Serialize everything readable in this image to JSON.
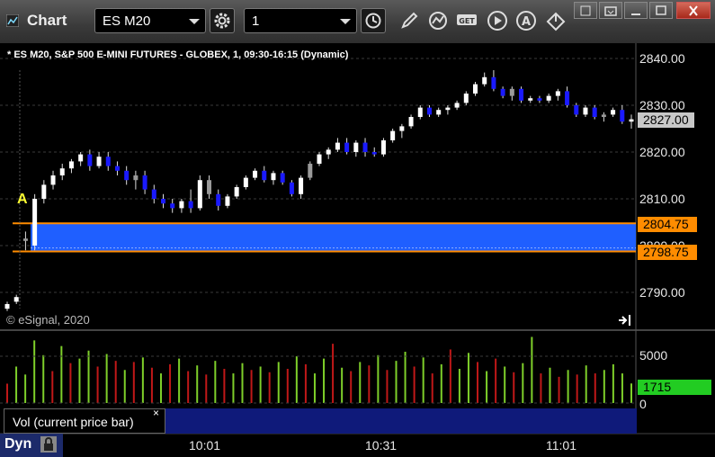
{
  "window": {
    "title": "Chart"
  },
  "toolbar": {
    "symbol_value": "ES M20",
    "interval_value": "1",
    "icons": [
      "settings-icon",
      "clock-icon",
      "pencil-icon",
      "indicator-icon",
      "get-icon",
      "play-icon",
      "alert-icon",
      "cursor-icon"
    ]
  },
  "chart": {
    "header_text": "* ES M20, S&P 500 E-MINI FUTURES - GLOBEX, 1, 09:30-16:15 (Dynamic)",
    "copyright": "© eSignal, 2020",
    "marker_label": "A",
    "price_axis": [
      "2840.00",
      "2830.00",
      "2820.00",
      "2810.00",
      "2800.00",
      "2790.00"
    ],
    "last_price": "2827.00",
    "zone_high": "2804.75",
    "zone_low": "2798.75",
    "time_axis": [
      "10:01",
      "10:31",
      "11:01"
    ],
    "colors": {
      "up_candle": "#ffffff",
      "down_candle": "#1a1aff",
      "zone_fill": "#1f5fff",
      "zone_border": "#ff8c00",
      "volume_up": "#7ecf2a",
      "volume_down": "#c01818",
      "last_price_bg": "#c8c8c8",
      "volume_last_bg": "#22cc22"
    }
  },
  "volume": {
    "axis": [
      "5000",
      "0"
    ],
    "last_value": "1715",
    "study_label": "Vol (current price bar)",
    "close_glyph": "×"
  },
  "status": {
    "mode": "Dyn"
  },
  "chart_data": {
    "type": "candlestick",
    "price_range": [
      2786,
      2843
    ],
    "candles": [
      {
        "o": 2786.5,
        "h": 2788,
        "l": 2786,
        "c": 2787.5,
        "dir": "up"
      },
      {
        "o": 2788,
        "h": 2789.5,
        "l": 2787.5,
        "c": 2789,
        "dir": "up"
      },
      {
        "o": 2801,
        "h": 2803,
        "l": 2799,
        "c": 2801.5,
        "dir": "flat"
      },
      {
        "o": 2800,
        "h": 2811,
        "l": 2799,
        "c": 2810,
        "dir": "up"
      },
      {
        "o": 2810,
        "h": 2814,
        "l": 2809,
        "c": 2813,
        "dir": "up"
      },
      {
        "o": 2813,
        "h": 2816,
        "l": 2812,
        "c": 2815,
        "dir": "up"
      },
      {
        "o": 2815,
        "h": 2817.5,
        "l": 2814,
        "c": 2816.5,
        "dir": "up"
      },
      {
        "o": 2816.5,
        "h": 2818.5,
        "l": 2815.5,
        "c": 2818,
        "dir": "up"
      },
      {
        "o": 2818,
        "h": 2820,
        "l": 2817,
        "c": 2819.5,
        "dir": "up"
      },
      {
        "o": 2819.5,
        "h": 2820.5,
        "l": 2816,
        "c": 2817,
        "dir": "down"
      },
      {
        "o": 2817,
        "h": 2820,
        "l": 2816.5,
        "c": 2819,
        "dir": "up"
      },
      {
        "o": 2819,
        "h": 2820,
        "l": 2816,
        "c": 2817,
        "dir": "down"
      },
      {
        "o": 2817,
        "h": 2818,
        "l": 2815,
        "c": 2816,
        "dir": "down"
      },
      {
        "o": 2816,
        "h": 2817,
        "l": 2813,
        "c": 2814,
        "dir": "down"
      },
      {
        "o": 2814,
        "h": 2816,
        "l": 2812,
        "c": 2815,
        "dir": "flat"
      },
      {
        "o": 2815,
        "h": 2816,
        "l": 2811,
        "c": 2812,
        "dir": "down"
      },
      {
        "o": 2812,
        "h": 2813,
        "l": 2809,
        "c": 2810,
        "dir": "down"
      },
      {
        "o": 2810,
        "h": 2811,
        "l": 2808,
        "c": 2809,
        "dir": "down"
      },
      {
        "o": 2809,
        "h": 2810,
        "l": 2807,
        "c": 2808,
        "dir": "down"
      },
      {
        "o": 2808,
        "h": 2810,
        "l": 2807,
        "c": 2809.5,
        "dir": "up"
      },
      {
        "o": 2809.5,
        "h": 2812,
        "l": 2807,
        "c": 2808,
        "dir": "down"
      },
      {
        "o": 2808,
        "h": 2815,
        "l": 2807.5,
        "c": 2814,
        "dir": "up"
      },
      {
        "o": 2814,
        "h": 2815,
        "l": 2810,
        "c": 2811,
        "dir": "flat"
      },
      {
        "o": 2811,
        "h": 2812,
        "l": 2807.5,
        "c": 2808.5,
        "dir": "down"
      },
      {
        "o": 2808.5,
        "h": 2811,
        "l": 2808,
        "c": 2810.5,
        "dir": "up"
      },
      {
        "o": 2810.5,
        "h": 2813,
        "l": 2810,
        "c": 2812.5,
        "dir": "up"
      },
      {
        "o": 2812.5,
        "h": 2815,
        "l": 2812,
        "c": 2814.5,
        "dir": "up"
      },
      {
        "o": 2814.5,
        "h": 2816.5,
        "l": 2814,
        "c": 2816,
        "dir": "up"
      },
      {
        "o": 2816,
        "h": 2817,
        "l": 2813.5,
        "c": 2814,
        "dir": "down"
      },
      {
        "o": 2814,
        "h": 2816,
        "l": 2813,
        "c": 2815.5,
        "dir": "up"
      },
      {
        "o": 2815.5,
        "h": 2816,
        "l": 2813,
        "c": 2813.5,
        "dir": "down"
      },
      {
        "o": 2813.5,
        "h": 2814,
        "l": 2810.5,
        "c": 2811,
        "dir": "down"
      },
      {
        "o": 2811,
        "h": 2815,
        "l": 2810,
        "c": 2814.5,
        "dir": "up"
      },
      {
        "o": 2814.5,
        "h": 2818,
        "l": 2814,
        "c": 2817.5,
        "dir": "flat"
      },
      {
        "o": 2817.5,
        "h": 2820,
        "l": 2817,
        "c": 2819.5,
        "dir": "up"
      },
      {
        "o": 2819.5,
        "h": 2821,
        "l": 2818.5,
        "c": 2820.5,
        "dir": "up"
      },
      {
        "o": 2820.5,
        "h": 2823,
        "l": 2820,
        "c": 2822,
        "dir": "up"
      },
      {
        "o": 2822,
        "h": 2823,
        "l": 2819.5,
        "c": 2820,
        "dir": "down"
      },
      {
        "o": 2820,
        "h": 2822.5,
        "l": 2819,
        "c": 2822,
        "dir": "up"
      },
      {
        "o": 2822,
        "h": 2823,
        "l": 2819,
        "c": 2820,
        "dir": "down"
      },
      {
        "o": 2820,
        "h": 2821,
        "l": 2819,
        "c": 2819.5,
        "dir": "down"
      },
      {
        "o": 2819.5,
        "h": 2823,
        "l": 2819,
        "c": 2822.5,
        "dir": "up"
      },
      {
        "o": 2822.5,
        "h": 2825,
        "l": 2822,
        "c": 2824.5,
        "dir": "up"
      },
      {
        "o": 2824.5,
        "h": 2826,
        "l": 2823,
        "c": 2825.5,
        "dir": "up"
      },
      {
        "o": 2825.5,
        "h": 2828,
        "l": 2825,
        "c": 2827.5,
        "dir": "up"
      },
      {
        "o": 2827.5,
        "h": 2830,
        "l": 2827,
        "c": 2829.5,
        "dir": "up"
      },
      {
        "o": 2829.5,
        "h": 2830,
        "l": 2827.5,
        "c": 2828,
        "dir": "down"
      },
      {
        "o": 2828,
        "h": 2829.5,
        "l": 2827.5,
        "c": 2829,
        "dir": "up"
      },
      {
        "o": 2829,
        "h": 2830,
        "l": 2828,
        "c": 2829.5,
        "dir": "up"
      },
      {
        "o": 2829.5,
        "h": 2831,
        "l": 2829,
        "c": 2830.5,
        "dir": "up"
      },
      {
        "o": 2830.5,
        "h": 2833,
        "l": 2830,
        "c": 2832.5,
        "dir": "up"
      },
      {
        "o": 2832.5,
        "h": 2835,
        "l": 2832,
        "c": 2834.5,
        "dir": "up"
      },
      {
        "o": 2834.5,
        "h": 2837,
        "l": 2834,
        "c": 2836,
        "dir": "up"
      },
      {
        "o": 2836,
        "h": 2837.5,
        "l": 2833,
        "c": 2833.5,
        "dir": "down"
      },
      {
        "o": 2833.5,
        "h": 2834,
        "l": 2831.5,
        "c": 2832,
        "dir": "down"
      },
      {
        "o": 2832,
        "h": 2834,
        "l": 2831,
        "c": 2833.5,
        "dir": "flat"
      },
      {
        "o": 2833.5,
        "h": 2834,
        "l": 2830.5,
        "c": 2831,
        "dir": "down"
      },
      {
        "o": 2831,
        "h": 2832,
        "l": 2830.5,
        "c": 2831.5,
        "dir": "up"
      },
      {
        "o": 2831.5,
        "h": 2832,
        "l": 2830.5,
        "c": 2831,
        "dir": "down"
      },
      {
        "o": 2831,
        "h": 2832.5,
        "l": 2830.5,
        "c": 2832,
        "dir": "up"
      },
      {
        "o": 2832,
        "h": 2833.5,
        "l": 2831,
        "c": 2833,
        "dir": "up"
      },
      {
        "o": 2833,
        "h": 2834,
        "l": 2829.5,
        "c": 2830,
        "dir": "down"
      },
      {
        "o": 2830,
        "h": 2830.5,
        "l": 2827.5,
        "c": 2828,
        "dir": "down"
      },
      {
        "o": 2828,
        "h": 2830,
        "l": 2827.5,
        "c": 2829.5,
        "dir": "up"
      },
      {
        "o": 2829.5,
        "h": 2830,
        "l": 2827,
        "c": 2827.5,
        "dir": "down"
      },
      {
        "o": 2827.5,
        "h": 2828.5,
        "l": 2826.5,
        "c": 2828,
        "dir": "flat"
      },
      {
        "o": 2828,
        "h": 2829.5,
        "l": 2827.5,
        "c": 2829,
        "dir": "up"
      },
      {
        "o": 2829,
        "h": 2830,
        "l": 2826,
        "c": 2826.5,
        "dir": "down"
      },
      {
        "o": 2826.5,
        "h": 2828,
        "l": 2825,
        "c": 2827,
        "dir": "up"
      }
    ],
    "volume": [
      {
        "v": 1700,
        "dir": "down"
      },
      {
        "v": 3200,
        "dir": "up"
      },
      {
        "v": 2500,
        "dir": "up"
      },
      {
        "v": 5500,
        "dir": "up"
      },
      {
        "v": 4200,
        "dir": "up"
      },
      {
        "v": 2800,
        "dir": "down"
      },
      {
        "v": 5000,
        "dir": "up"
      },
      {
        "v": 3500,
        "dir": "down"
      },
      {
        "v": 3900,
        "dir": "up"
      },
      {
        "v": 4600,
        "dir": "up"
      },
      {
        "v": 3200,
        "dir": "down"
      },
      {
        "v": 4300,
        "dir": "up"
      },
      {
        "v": 3700,
        "dir": "down"
      },
      {
        "v": 2900,
        "dir": "up"
      },
      {
        "v": 3600,
        "dir": "down"
      },
      {
        "v": 4000,
        "dir": "up"
      },
      {
        "v": 3100,
        "dir": "down"
      },
      {
        "v": 2600,
        "dir": "up"
      },
      {
        "v": 3400,
        "dir": "down"
      },
      {
        "v": 3900,
        "dir": "up"
      },
      {
        "v": 2800,
        "dir": "down"
      },
      {
        "v": 3300,
        "dir": "up"
      },
      {
        "v": 2500,
        "dir": "down"
      },
      {
        "v": 3700,
        "dir": "up"
      },
      {
        "v": 3000,
        "dir": "down"
      },
      {
        "v": 2600,
        "dir": "up"
      },
      {
        "v": 3500,
        "dir": "up"
      },
      {
        "v": 2900,
        "dir": "down"
      },
      {
        "v": 3200,
        "dir": "up"
      },
      {
        "v": 2700,
        "dir": "down"
      },
      {
        "v": 3600,
        "dir": "up"
      },
      {
        "v": 3000,
        "dir": "down"
      },
      {
        "v": 4100,
        "dir": "up"
      },
      {
        "v": 3400,
        "dir": "down"
      },
      {
        "v": 2600,
        "dir": "up"
      },
      {
        "v": 3900,
        "dir": "up"
      },
      {
        "v": 5200,
        "dir": "down"
      },
      {
        "v": 3100,
        "dir": "up"
      },
      {
        "v": 2800,
        "dir": "down"
      },
      {
        "v": 3600,
        "dir": "up"
      },
      {
        "v": 3300,
        "dir": "down"
      },
      {
        "v": 4200,
        "dir": "up"
      },
      {
        "v": 2900,
        "dir": "down"
      },
      {
        "v": 3700,
        "dir": "up"
      },
      {
        "v": 4500,
        "dir": "up"
      },
      {
        "v": 3200,
        "dir": "down"
      },
      {
        "v": 4000,
        "dir": "up"
      },
      {
        "v": 2600,
        "dir": "down"
      },
      {
        "v": 3400,
        "dir": "up"
      },
      {
        "v": 4700,
        "dir": "down"
      },
      {
        "v": 3000,
        "dir": "up"
      },
      {
        "v": 4400,
        "dir": "up"
      },
      {
        "v": 3600,
        "dir": "down"
      },
      {
        "v": 2800,
        "dir": "up"
      },
      {
        "v": 3900,
        "dir": "down"
      },
      {
        "v": 3200,
        "dir": "up"
      },
      {
        "v": 2700,
        "dir": "down"
      },
      {
        "v": 3500,
        "dir": "up"
      },
      {
        "v": 5800,
        "dir": "up"
      },
      {
        "v": 2600,
        "dir": "down"
      },
      {
        "v": 3100,
        "dir": "up"
      },
      {
        "v": 2300,
        "dir": "down"
      },
      {
        "v": 2900,
        "dir": "up"
      },
      {
        "v": 2500,
        "dir": "down"
      },
      {
        "v": 3300,
        "dir": "up"
      },
      {
        "v": 2600,
        "dir": "down"
      },
      {
        "v": 2900,
        "dir": "up"
      },
      {
        "v": 3400,
        "dir": "up"
      },
      {
        "v": 2600,
        "dir": "up"
      },
      {
        "v": 1715,
        "dir": "up"
      }
    ],
    "volume_range": [
      0,
      6000
    ]
  }
}
